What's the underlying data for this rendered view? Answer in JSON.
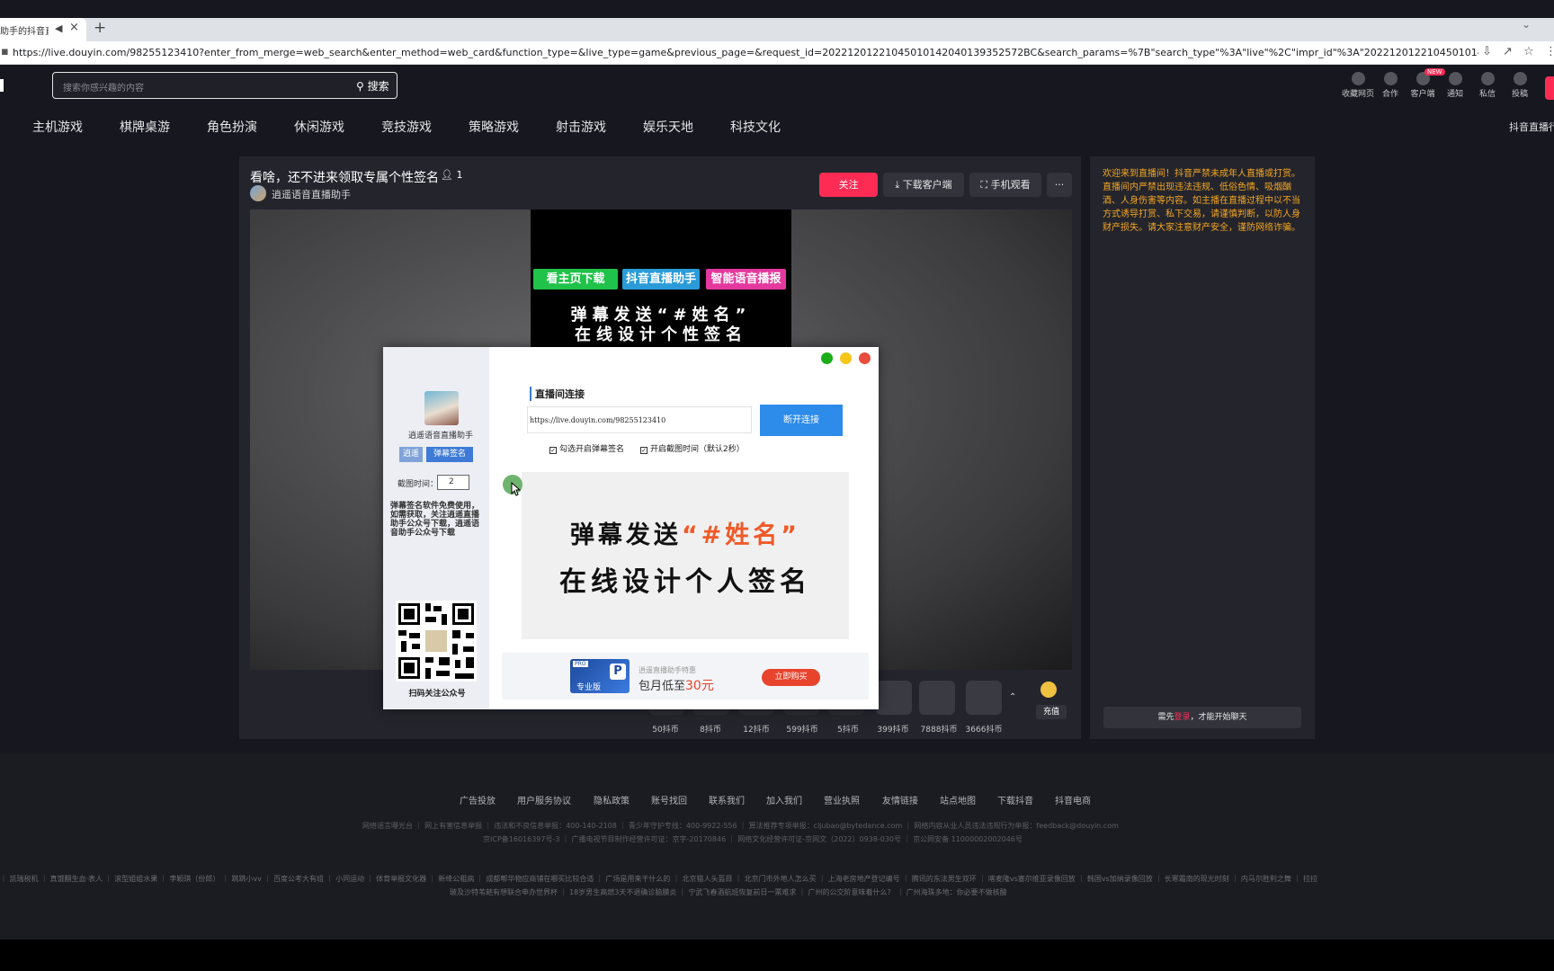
{
  "browser": {
    "tab_title": "助手的抖音直播",
    "url": "https://live.douyin.com/98255123410?enter_from_merge=web_search&enter_method=web_card&function_type=&live_type=game&previous_page=&request_id=20221201221045010142040139352572BC&search_params=%7B\"search_type\"%3A\"live\"%2C\"impr_id\"%3A\"20221201221045010142040139352572BC\"%2C\"searc..."
  },
  "header": {
    "search_placeholder": "搜索你感兴趣的内容",
    "search_button": "搜索",
    "icons": [
      {
        "label": "收藏网页",
        "icon": "star-icon"
      },
      {
        "label": "合作",
        "icon": "handshake-icon"
      },
      {
        "label": "客户端",
        "icon": "client-icon"
      },
      {
        "label": "通知",
        "icon": "bell-icon"
      },
      {
        "label": "私信",
        "icon": "message-icon"
      },
      {
        "label": "投稿",
        "icon": "upload-icon"
      }
    ],
    "new_badge": "NEW"
  },
  "categories": [
    "主机游戏",
    "棋牌桌游",
    "角色扮演",
    "休闲游戏",
    "竞技游戏",
    "策略游戏",
    "射击游戏",
    "娱乐天地",
    "科技文化"
  ],
  "categories_right": "抖音直播行",
  "room": {
    "title": "看啥，还不进来领取专属个性签名",
    "viewer_count": "1",
    "streamer": "逍遥语音直播助手",
    "follow": "关注",
    "download_client": "下载客户端",
    "mobile_watch": "手机观看",
    "more": "···"
  },
  "video": {
    "tags": [
      "看主页下载",
      "抖音直播助手",
      "智能语音播报"
    ],
    "line1": "弹幕发送“#姓名”",
    "line2": "在线设计个性签名"
  },
  "gifts": {
    "prices": [
      "50抖币",
      "8抖币",
      "12抖币",
      "599抖币",
      "5抖币",
      "399抖币",
      "7888抖币",
      "3666抖币"
    ],
    "recharge": "充值",
    "collapse": "⌃"
  },
  "chat": {
    "notice": "欢迎来到直播间！抖音严禁未成年人直播或打赏。直播间内严禁出现违法违规、低俗色情、吸烟酗酒、人身伤害等内容。如主播在直播过程中以不当方式诱导打赏、私下交易，请谨慎判断，以防人身财产损失。请大家注意财产安全，谨防网络诈骗。",
    "login_prefix": "需先",
    "login_link": "登录",
    "login_suffix": "，才能开始聊天"
  },
  "footer": {
    "links": [
      "广告投放",
      "用户服务协议",
      "隐私政策",
      "账号找回",
      "联系我们",
      "加入我们",
      "营业执照",
      "友情链接",
      "站点地图",
      "下载抖音",
      "抖音电商"
    ],
    "license1": "网络谣言曝光台 ｜ 网上有害信息举报 ｜ 违法和不良信息举报：400-140-2108 ｜ 青少年守护专线：400-9922-556 ｜ 算法推荐专项举报：cljubao@bytedance.com ｜ 网络内容从业人员违法违规行为举报：feedback@douyin.com",
    "license2": "京ICP备16016397号-3 ｜ 广播电视节目制作经营许可证：京字-20170846 ｜ 网络文化经营许可证-京网文（2022）0938-030号 ｜ 京公网安备 11000002002046号",
    "hot1": "｜ 凯瑞税机 ｜ 真饿翻生血·表人 ｜ 滚型姐姐水果 ｜ 李颖琪（份郎） ｜ 跳跳小vv ｜ 百度公考大有组 ｜ 小同运动 ｜ 体育举报文化器 ｜ 新绛公粗病 ｜ 成都郫华物应商铺在哪买比较合适 ｜ 广场是用来干什么的 ｜ 北京猫人头盔目 ｜ 北京门市外地人怎么买 ｜ 上海老房地产登记编号 ｜ 腾讯的东法男生双环 ｜ 喀麦隆vs塞尔维亚录像回放 ｜ 韩国vs加纳录像回放 ｜ 长寒霜南的现光时刻 ｜ 内马尔胜利之舞 ｜ 拉拉",
    "hot2": "玻及沙特苇葩有想联合申办世界杯 ｜ 18岁男生高燃3天不退确诊脑膜炎 ｜ 宁武飞春酒航班恢复前日一票难求 ｜ 广州的公交阶意味着什么？ ｜ 广州海珠多地：你必要不做核酸"
  },
  "app": {
    "name": "逍遥语音直播助手",
    "tab_a": "逍遥",
    "tab_b": "弹幕签名",
    "interval_label": "截图时间：",
    "interval_value": "2",
    "side_desc": "弹幕签名软件免费使用，如需获取，关注逍遥直播助手公众号下载，逍遥语音助手公众号下载",
    "qr_caption": "扫码关注公众号",
    "conn_title": "直播间连接",
    "conn_url": "https://live.douyin.com/98255123410",
    "conn_button": "断开连接",
    "check1": "勾选开启弹幕签名",
    "check2": "开启截图时间（默认2秒）",
    "preview_line1_a": "弹幕发送",
    "preview_line1_b": "“#姓名”",
    "preview_line2": "在线设计个人签名",
    "ad_badge": "PRO",
    "ad_plan": "专业版",
    "ad_sub": "逍遥直播助手特惠",
    "ad_main_a": "包月低至",
    "ad_main_b": "30元",
    "ad_buy": "立即购买",
    "window_dots": [
      "#1aad19",
      "#f5c518",
      "#e84c3d"
    ]
  }
}
